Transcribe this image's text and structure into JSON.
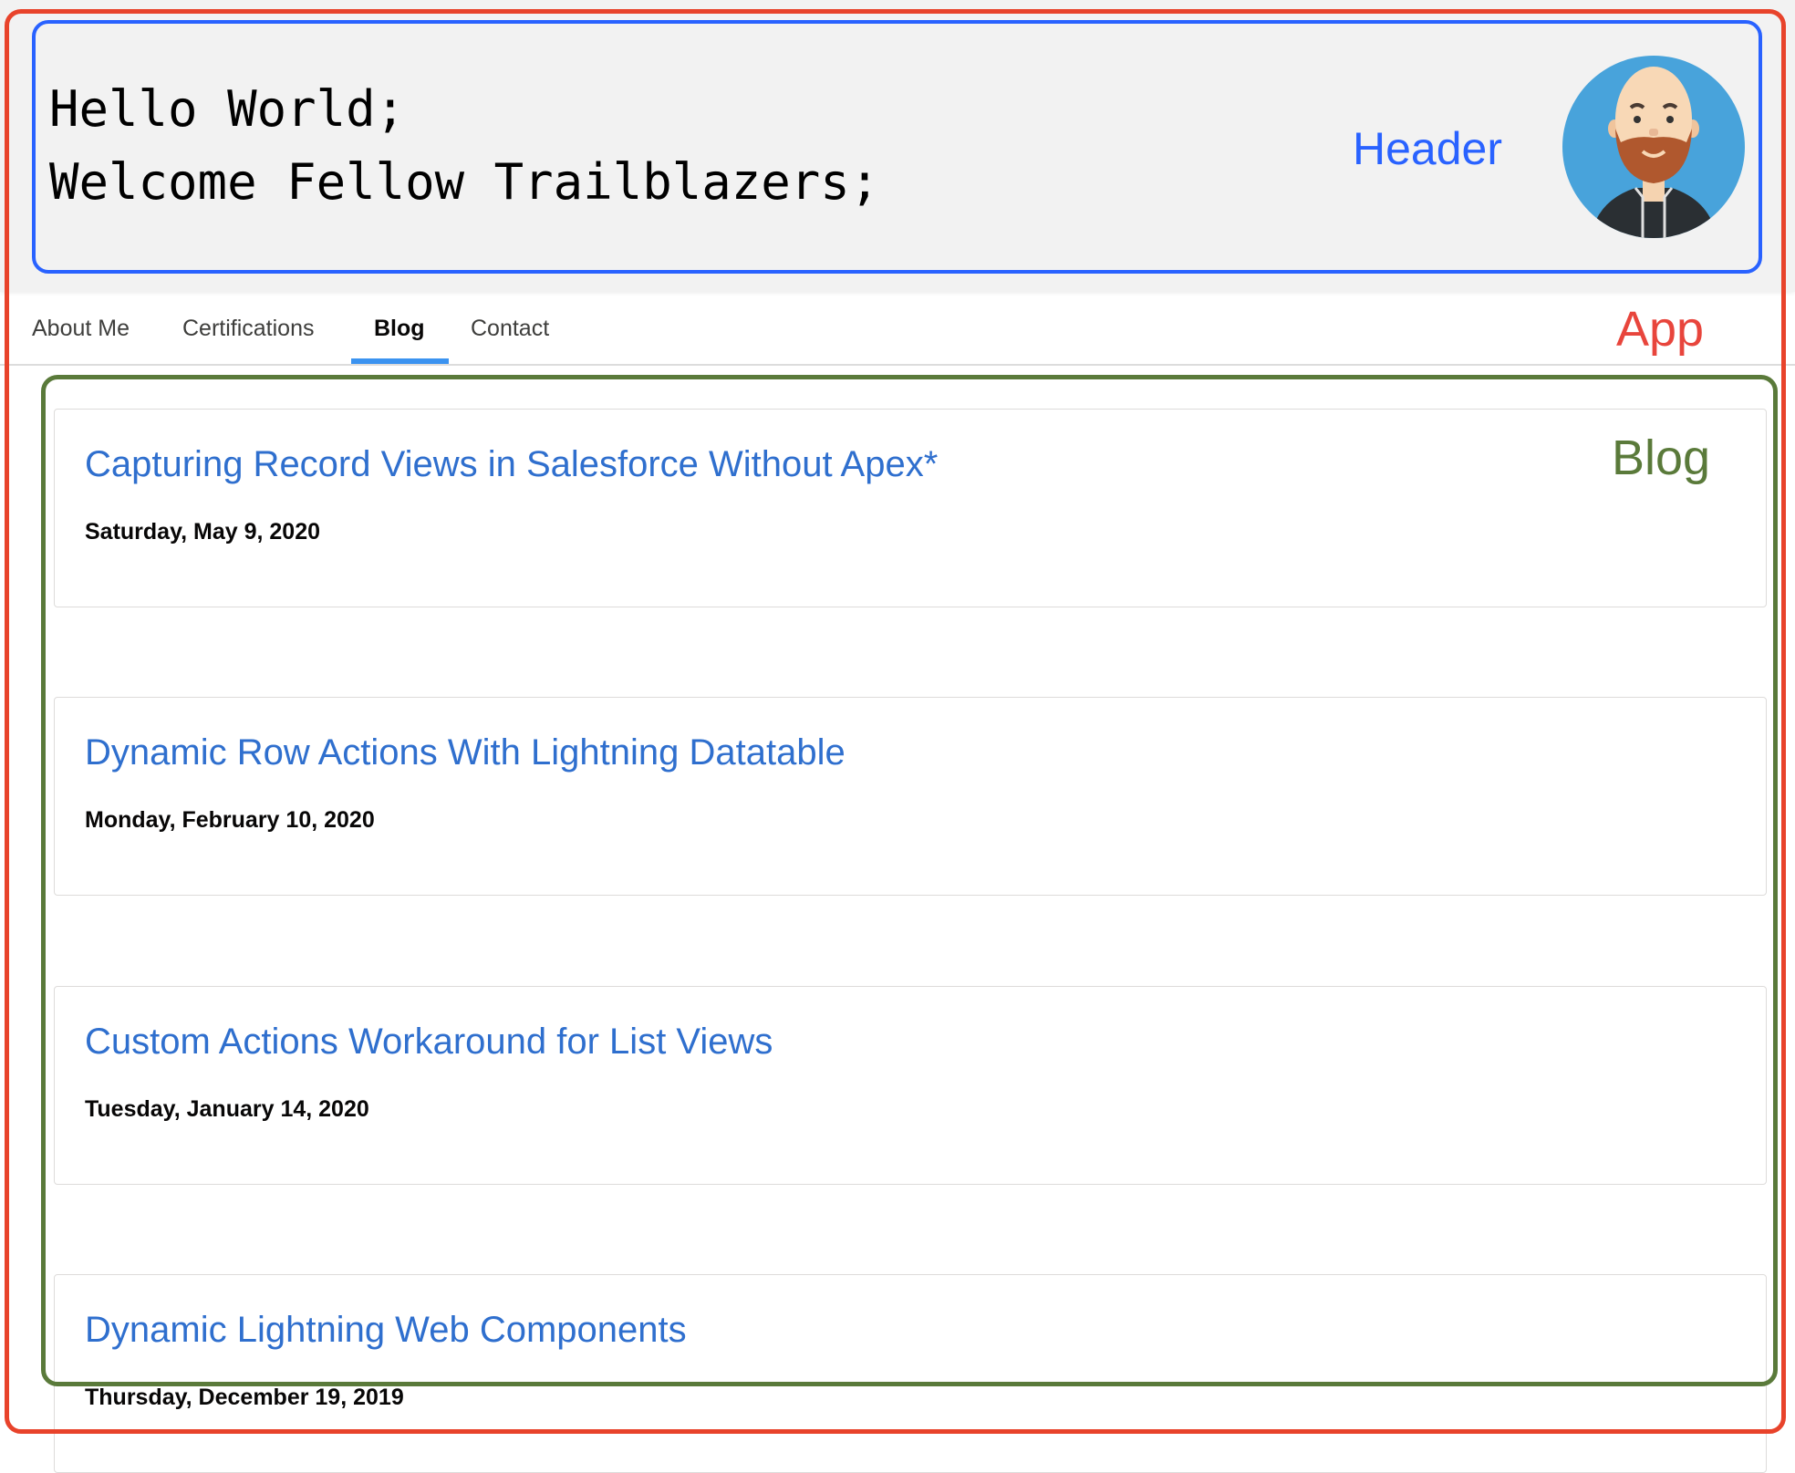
{
  "header": {
    "greeting_line1": "Hello World;",
    "greeting_line2": "Welcome Fellow Trailblazers;",
    "region_label": "Header",
    "avatar_icon": "bearded-man-avatar-icon"
  },
  "app": {
    "region_label": "App"
  },
  "nav": {
    "tabs": [
      {
        "label": "About Me"
      },
      {
        "label": "Certifications"
      },
      {
        "label": "Blog",
        "active": true
      },
      {
        "label": "Contact"
      }
    ]
  },
  "blog": {
    "region_label": "Blog",
    "posts": [
      {
        "title": "Capturing Record Views in Salesforce Without Apex*",
        "date": "Saturday, May 9, 2020"
      },
      {
        "title": "Dynamic Row Actions With Lightning Datatable",
        "date": "Monday, February 10, 2020"
      },
      {
        "title": "Custom Actions Workaround for List Views",
        "date": "Tuesday, January 14, 2020"
      },
      {
        "title": "Dynamic Lightning Web Components",
        "date": "Thursday, December 19, 2019"
      }
    ]
  },
  "colors": {
    "app_outline": "#e8432b",
    "header_outline": "#2962ff",
    "blog_outline": "#5a7a3a",
    "link": "#2f6fce",
    "active_tab": "#3b93f0"
  }
}
